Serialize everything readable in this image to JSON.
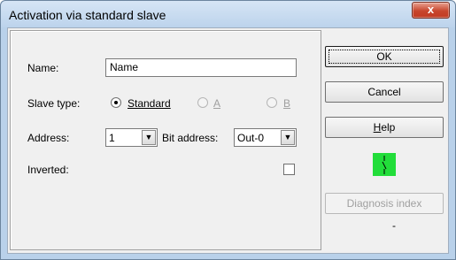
{
  "window": {
    "title": "Activation via standard slave",
    "close_glyph": "x"
  },
  "form": {
    "name_label": "Name:",
    "name_value": "Name",
    "slave_type_label": "Slave type:",
    "slave_options": [
      {
        "label": "Standard",
        "selected": true,
        "enabled": true
      },
      {
        "label": "A",
        "selected": false,
        "enabled": false
      },
      {
        "label": "B",
        "selected": false,
        "enabled": false
      }
    ],
    "address_label": "Address:",
    "address_value": "1",
    "bit_address_label": "Bit address:",
    "bit_address_value": "Out-0",
    "inverted_label": "Inverted:",
    "inverted_checked": false
  },
  "buttons": {
    "ok": "OK",
    "cancel": "Cancel",
    "help": "Help",
    "diagnosis": "Diagnosis index"
  },
  "status": {
    "diagnosis_value": "-",
    "indicator_color": "#22dd3a",
    "indicator_icon": "switch-contact-icon"
  }
}
